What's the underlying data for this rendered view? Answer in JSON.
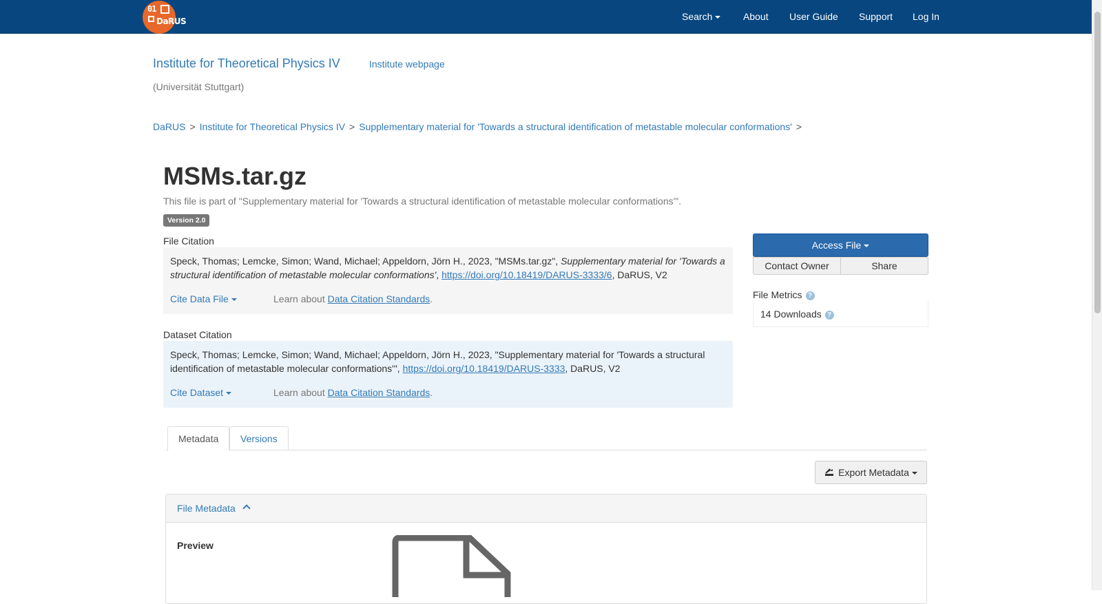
{
  "navbar": {
    "logo_digits": "01",
    "logo_text": "DaRUS",
    "search": "Search",
    "about": "About",
    "user_guide": "User Guide",
    "support": "Support",
    "login": "Log In"
  },
  "dataverse": {
    "name": "Institute for Theoretical Physics IV",
    "webpage_link": "Institute webpage",
    "affiliation": "(Universität Stuttgart)"
  },
  "breadcrumb": {
    "items": [
      "DaRUS",
      "Institute for Theoretical Physics IV",
      "Supplementary material for 'Towards a structural identification of metastable molecular conformations'"
    ],
    "separator": ">"
  },
  "file": {
    "title": "MSMs.tar.gz",
    "part_of": "This file is part of \"Supplementary material for 'Towards a structural identification of metastable molecular conformations'\".",
    "version": "Version 2.0"
  },
  "file_citation": {
    "label": "File Citation",
    "authors": "Speck, Thomas; Lemcke, Simon; Wand, Michael; Appeldorn, Jörn H., 2023, \"MSMs.tar.gz\", ",
    "dataset_title": "Supplementary material for 'Towards a structural identification of metastable molecular conformations'",
    "sep": ", ",
    "doi": "https://doi.org/10.18419/DARUS-3333/6",
    "suffix": ", DaRUS, V2",
    "cite_button": "Cite Data File",
    "learn_prefix": "Learn about ",
    "learn_link": "Data Citation Standards",
    "learn_suffix": "."
  },
  "dataset_citation": {
    "label": "Dataset Citation",
    "text": "Speck, Thomas; Lemcke, Simon; Wand, Michael; Appeldorn, Jörn H., 2023, \"Supplementary material for 'Towards a structural identification of metastable molecular conformations'\", ",
    "doi": "https://doi.org/10.18419/DARUS-3333",
    "suffix": ", DaRUS, V2",
    "cite_button": "Cite Dataset",
    "learn_prefix": "Learn about ",
    "learn_link": "Data Citation Standards",
    "learn_suffix": "."
  },
  "actions": {
    "access_file": "Access File",
    "contact_owner": "Contact Owner",
    "share": "Share"
  },
  "metrics": {
    "label": "File Metrics",
    "downloads": "14 Downloads",
    "help_glyph": "?"
  },
  "tabs": [
    "Metadata",
    "Versions"
  ],
  "export_metadata": "Export Metadata",
  "panel": {
    "heading": "File Metadata",
    "preview_label": "Preview"
  },
  "colors": {
    "navbar": "#07467f",
    "logo": "#e8672a",
    "link": "#337ab7",
    "primary_button": "#2a6aad",
    "dataset_citation_bg": "#ebf3fa"
  }
}
